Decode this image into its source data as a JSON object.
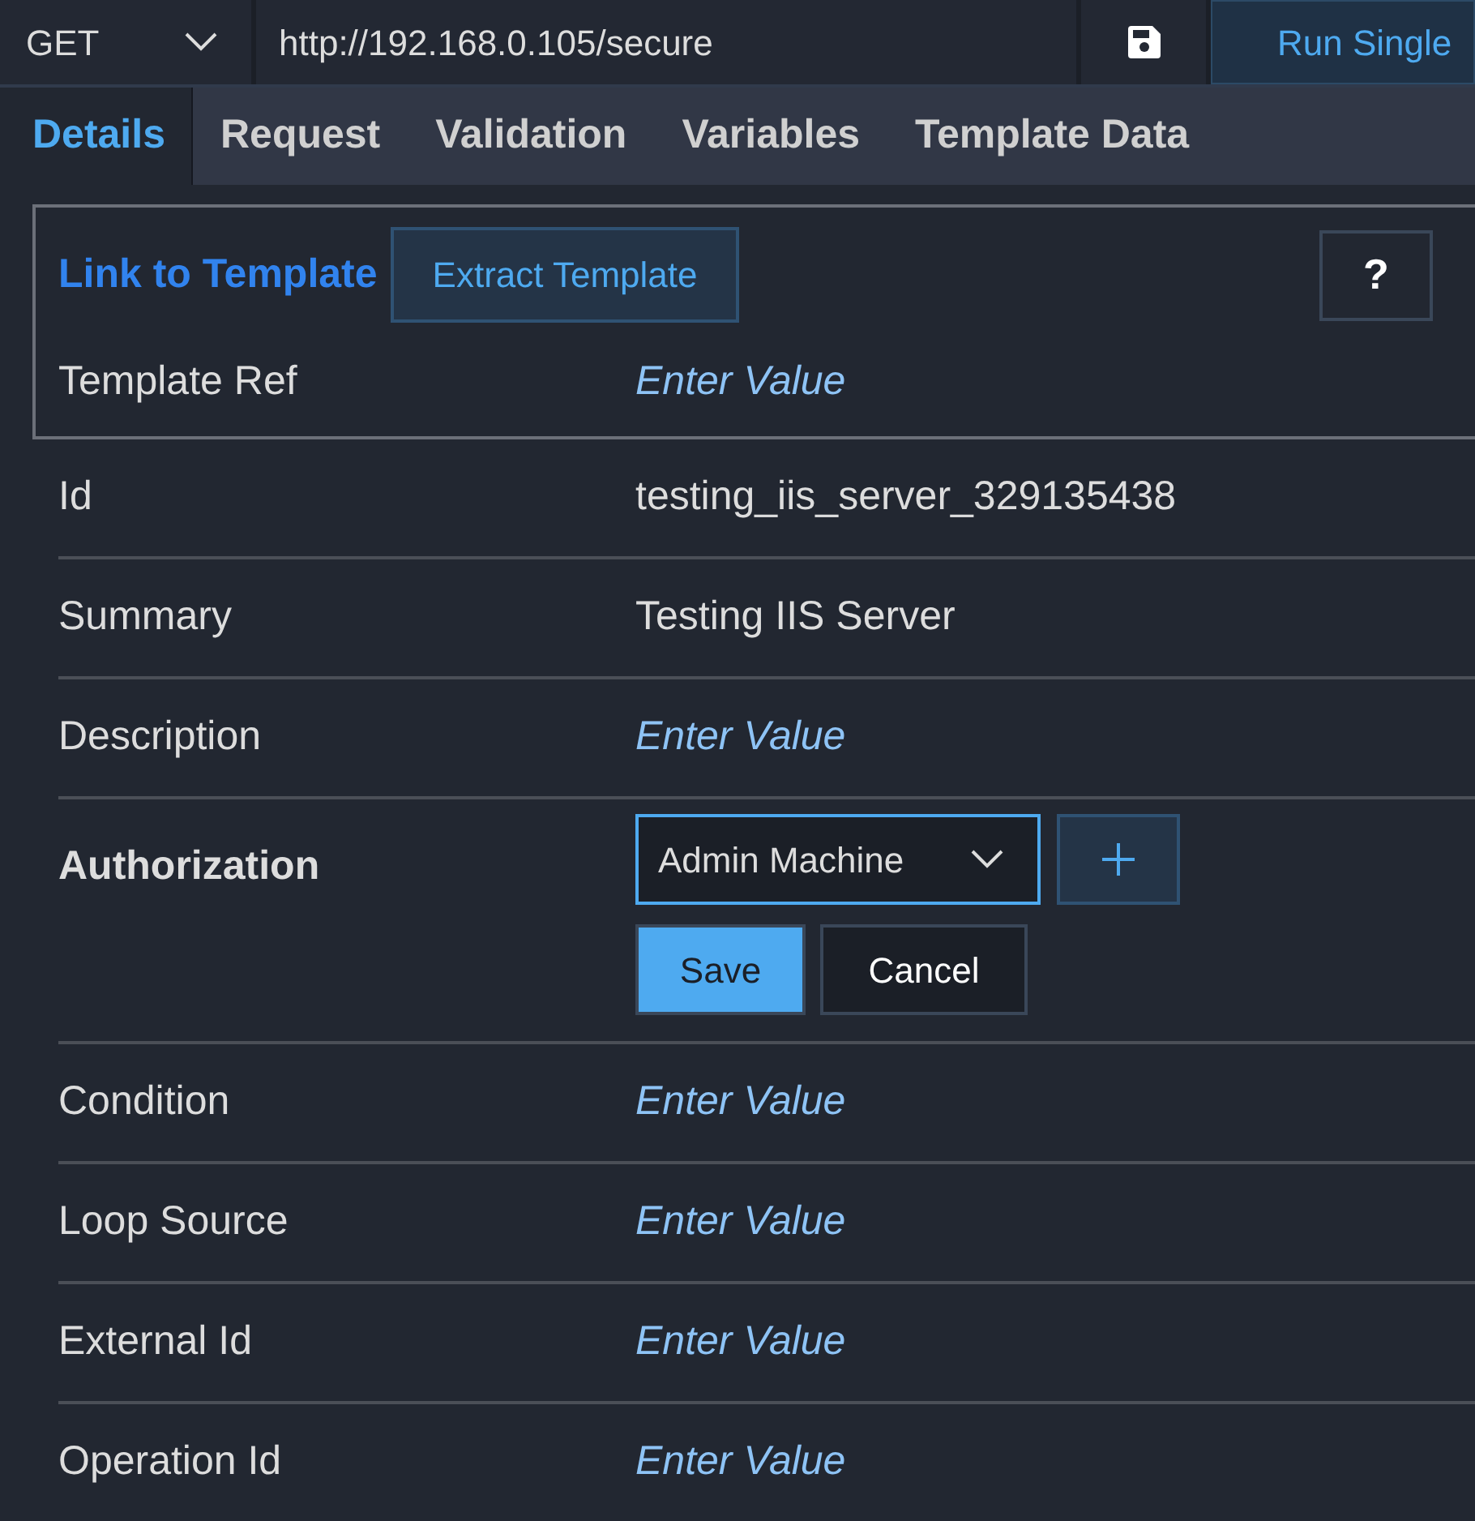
{
  "toolbar": {
    "method": "GET",
    "url": "http://192.168.0.105/secure",
    "run_button": "Run Single"
  },
  "tabs": [
    {
      "label": "Details",
      "selected": true
    },
    {
      "label": "Request",
      "selected": false
    },
    {
      "label": "Validation",
      "selected": false
    },
    {
      "label": "Variables",
      "selected": false
    },
    {
      "label": "Template Data",
      "selected": false
    }
  ],
  "template": {
    "link": "Link to Template",
    "extract_button": "Extract Template",
    "help_button": "?",
    "ref_label": "Template Ref",
    "ref_placeholder": "Enter Value"
  },
  "fields": [
    {
      "kind": "text",
      "label": "Id",
      "value": "testing_iis_server_329135438"
    },
    {
      "kind": "text",
      "label": "Summary",
      "value": "Testing IIS Server"
    },
    {
      "kind": "text",
      "label": "Description",
      "placeholder": "Enter Value"
    },
    {
      "kind": "select",
      "label": "Authorization",
      "value": "Admin Machine",
      "buttons": [
        "Save",
        "Cancel"
      ]
    },
    {
      "kind": "text",
      "label": "Condition",
      "placeholder": "Enter Value"
    },
    {
      "kind": "text",
      "label": "Loop Source",
      "placeholder": "Enter Value"
    },
    {
      "kind": "text",
      "label": "External Id",
      "placeholder": "Enter Value"
    },
    {
      "kind": "text",
      "label": "Operation Id",
      "placeholder": "Enter Value"
    }
  ]
}
